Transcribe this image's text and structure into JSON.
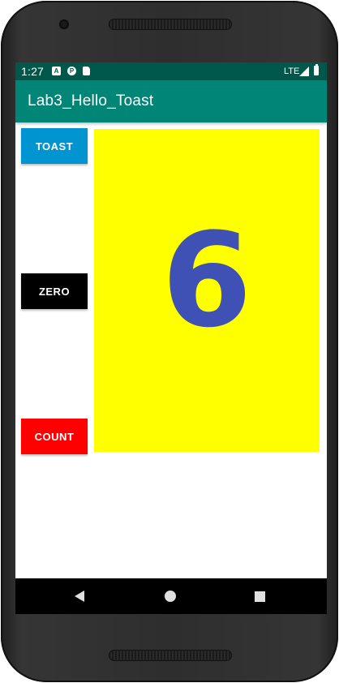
{
  "status_bar": {
    "time": "1:27",
    "notification_icons": [
      "a-icon",
      "p-icon",
      "sd-card-icon"
    ],
    "network": "LTE"
  },
  "app_bar": {
    "title": "Lab3_Hello_Toast",
    "color": "#008577"
  },
  "buttons": {
    "toast": {
      "label": "TOAST",
      "color": "#0095d0"
    },
    "zero": {
      "label": "ZERO",
      "color": "#000000"
    },
    "count": {
      "label": "COUNT",
      "color": "#ff0000"
    }
  },
  "count_display": {
    "value": "6",
    "background": "#ffff00",
    "text_color": "#3f51b5"
  },
  "nav_bar": {
    "icons": [
      "back-icon",
      "home-icon",
      "recents-icon"
    ]
  }
}
